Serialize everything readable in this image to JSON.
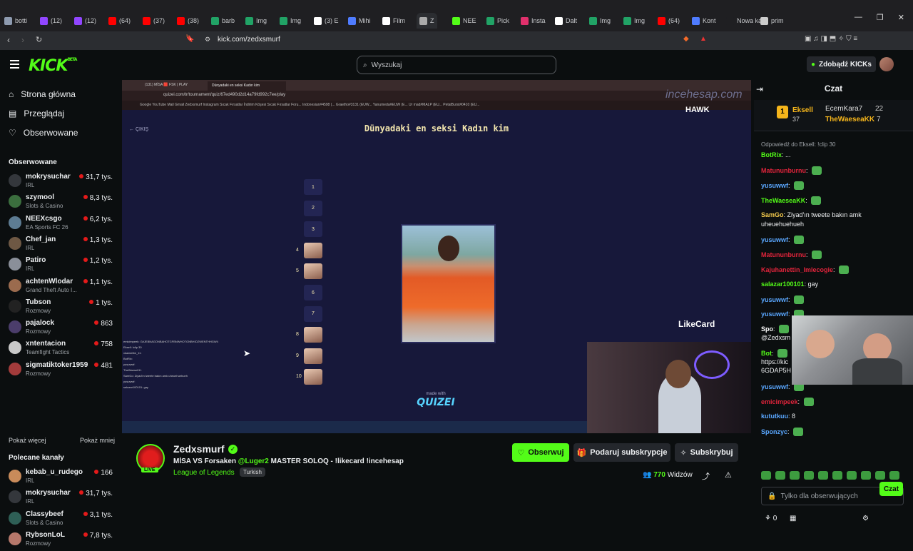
{
  "browser": {
    "tabs": [
      {
        "label": "botti",
        "color": "#8e9bb0"
      },
      {
        "label": "(12)",
        "color": "#9146ff"
      },
      {
        "label": "(12)",
        "color": "#9146ff"
      },
      {
        "label": "(64)",
        "color": "#ff0000"
      },
      {
        "label": "(37)",
        "color": "#ff0000"
      },
      {
        "label": "(38)",
        "color": "#ff0000"
      },
      {
        "label": "barb",
        "color": "#21a366"
      },
      {
        "label": "Img",
        "color": "#21a366"
      },
      {
        "label": "Img",
        "color": "#21a366"
      },
      {
        "label": "(3) E",
        "color": "#ffffff"
      },
      {
        "label": "Mihi",
        "color": "#4f7cff"
      },
      {
        "label": "Film",
        "color": "#ffffff"
      },
      {
        "label": "Z",
        "color": "#aaaaaa"
      },
      {
        "label": "NEE",
        "color": "#53fc18"
      },
      {
        "label": "Pick",
        "color": "#21a366"
      },
      {
        "label": "Insta",
        "color": "#e1306c"
      },
      {
        "label": "Dalt",
        "color": "#ffffff"
      },
      {
        "label": "Img",
        "color": "#21a366"
      },
      {
        "label": "Img",
        "color": "#21a366"
      },
      {
        "label": "(64)",
        "color": "#ff0000"
      },
      {
        "label": "Kont",
        "color": "#4f7cff"
      },
      {
        "label": "Nowa ka",
        "color": "#1f1f22"
      },
      {
        "label": "prim",
        "color": "#cccccc"
      }
    ],
    "url": "kick.com/zedxsmurf"
  },
  "nav": {
    "logo": "KICK",
    "logo_beta": "BETA",
    "search_placeholder": "Wyszukaj",
    "kicks_button": "Zdobądź KICKs"
  },
  "sidebar": {
    "home": "Strona główna",
    "browse": "Przeglądaj",
    "following": "Obserwowane",
    "followed_header": "Obserwowane",
    "followed": [
      {
        "name": "mokrysuchar",
        "category": "IRL",
        "viewers": "31,7 tys.",
        "color": "#34373c"
      },
      {
        "name": "szymool",
        "category": "Slots & Casino",
        "viewers": "8,3 tys.",
        "color": "#3b6e3e"
      },
      {
        "name": "NEEXcsgo",
        "category": "EA Sports FC 26",
        "viewers": "6,2 tys.",
        "color": "#5d7c93"
      },
      {
        "name": "Chef_jan",
        "category": "IRL",
        "viewers": "1,3 tys.",
        "color": "#6e5844"
      },
      {
        "name": "Patiro",
        "category": "IRL",
        "viewers": "1,2 tys.",
        "color": "#8a8f99"
      },
      {
        "name": "achtenWlodar",
        "category": "Grand Theft Auto I...",
        "viewers": "1,1 tys.",
        "color": "#9b6b4e"
      },
      {
        "name": "Tubson",
        "category": "Rozmowy",
        "viewers": "1 tys.",
        "color": "#222222"
      },
      {
        "name": "pajalock",
        "category": "Rozmowy",
        "viewers": "863",
        "color": "#4b3d6b"
      },
      {
        "name": "xntentacion",
        "category": "Teamfight Tactics",
        "viewers": "758",
        "color": "#c9c9c9"
      },
      {
        "name": "sigmatiktoker1959",
        "category": "Rozmowy",
        "viewers": "481",
        "color": "#a33b3b"
      }
    ],
    "show_more": "Pokaż więcej",
    "show_less": "Pokaż mniej",
    "recommended_header": "Polecane kanały",
    "recommended": [
      {
        "name": "kebab_u_rudego",
        "category": "IRL",
        "viewers": "166",
        "color": "#c98b5a"
      },
      {
        "name": "mokrysuchar",
        "category": "IRL",
        "viewers": "31,7 tys.",
        "color": "#34373c"
      },
      {
        "name": "Classybeef",
        "category": "Slots & Casino",
        "viewers": "3,1 tys.",
        "color": "#2e5f56"
      },
      {
        "name": "RybsonLoL",
        "category": "Rozmowy",
        "viewers": "7,8 tys.",
        "color": "#b6786b"
      }
    ]
  },
  "video": {
    "inner_tab1": "(131) MİSA 🟥 FSK | PLAY",
    "inner_tab2": "Dünyadaki en seksi Kadın kim",
    "inner_url": "quizei.com/tr/tournament/quiz/67ed490d2d14a79fd992c7ee/play",
    "inner_bookmarks": "Google   YouTube   Mail   Gmail   Zedxsmurf   Instagram   Sıcak Fırsatlar   İndirim Köşesi   Sıcak Fırsatlar Foru...   Indonesian#4598 (...   Graetho#3131 (EUW...   Yanumeda#EUW (E...   Ur mad#MALP (EU...   PetalBurst#0410 (EU...",
    "back": "← ÇIKIŞ",
    "quiz_title": "Dünyadaki en seksi Kadın kim",
    "ranks": [
      "1",
      "2",
      "3",
      "4",
      "5",
      "6",
      "7",
      "8",
      "9",
      "10"
    ],
    "made_with": "made with",
    "brand": "QUIZEI",
    "sponsor1": "incehesap.com",
    "sponsor2": "HAWK",
    "sponsor3": "LikeCard",
    "overlay_chat": [
      "emicimpeek: G#JEBNAGONBAHOTGFBNWHOTGNBHIOZWENTHHGW4",
      "Eksell: Iclip 30",
      "xkadzelbe_11: ",
      "BotRix: ",
      "yusuwwf: ",
      "TheWaeseKK: ",
      "SamGo: Ziyad'ın tweete bakın amk uheuehuehueh",
      "yusuwwf: ",
      "salazar100101: gay"
    ]
  },
  "streamer": {
    "name": "Zedxsmurf",
    "live": "LIVE",
    "title_pre": "MİSA VS Forsaken ",
    "title_tag": "@Luger2",
    "title_post": " MASTER SOLOQ - !likecard !incehesap",
    "category": "League of Legends",
    "language": "Turkish",
    "follow": "Obserwuj",
    "gift": "Podaruj subskrypcje",
    "subscribe": "Subskrybuj",
    "viewers_count": "770",
    "viewers_label": "Widzów"
  },
  "chat": {
    "title": "Czat",
    "pinned": {
      "rank": "1",
      "user": "Eksell",
      "count": "37",
      "gifter1": "EcemKara7",
      "gifter1_count": "22",
      "gifter2": "TheWaeseaKK",
      "gifter2_count": "7"
    },
    "reply_to": "Odpowiedź do Eksell: !clip 30",
    "messages": [
      {
        "user": "BotRix",
        "text": " ...",
        "color": "#53fc18"
      },
      {
        "user": "Matununburnu",
        "text": "",
        "color": "#e0243b"
      },
      {
        "user": "yusuwwf",
        "text": "",
        "color": "#5aa7ff"
      },
      {
        "user": "TheWaeseaKK",
        "text": "",
        "color": "#53fc18"
      },
      {
        "user": "SamGo",
        "text": "Ziyad'ın tweete bakın amk",
        "color": "#f2c94c"
      },
      {
        "user": "",
        "text": "uheuehuehueh",
        "color": "#ffffff"
      },
      {
        "user": "yusuwwf",
        "text": "",
        "color": "#5aa7ff"
      },
      {
        "user": "Matununburnu",
        "text": "",
        "color": "#e0243b"
      },
      {
        "user": "Kajuhanettin_Imlecogie",
        "text": "",
        "color": "#e0243b"
      },
      {
        "user": "salazar100101",
        "text": "gay",
        "color": "#53fc18"
      },
      {
        "user": "yusuwwf",
        "text": "",
        "color": "#5aa7ff"
      },
      {
        "user": "yusuwwf",
        "text": "",
        "color": "#5aa7ff"
      },
      {
        "user": "Spo",
        "text": "",
        "color": "#ffffff"
      },
      {
        "user": "",
        "text": "@Zedxsm",
        "color": "#ffffff"
      },
      {
        "user": "Bot",
        "text": "",
        "color": "#53fc18"
      },
      {
        "user": "",
        "text": "https://kic",
        "color": "#ffffff"
      },
      {
        "user": "",
        "text": "6GDAP5H",
        "color": "#ffffff"
      },
      {
        "user": "yusuwwf",
        "text": "",
        "color": "#5aa7ff"
      },
      {
        "user": "emicimpeek",
        "text": "",
        "color": "#e0243b"
      },
      {
        "user": "kututkuu",
        "text": "8",
        "color": "#5aa7ff"
      },
      {
        "user": "Sponzyc",
        "text": "",
        "color": "#5aa7ff"
      }
    ],
    "input_placeholder": "Tylko dla obserwujących",
    "points": "0",
    "send": "Czat"
  }
}
